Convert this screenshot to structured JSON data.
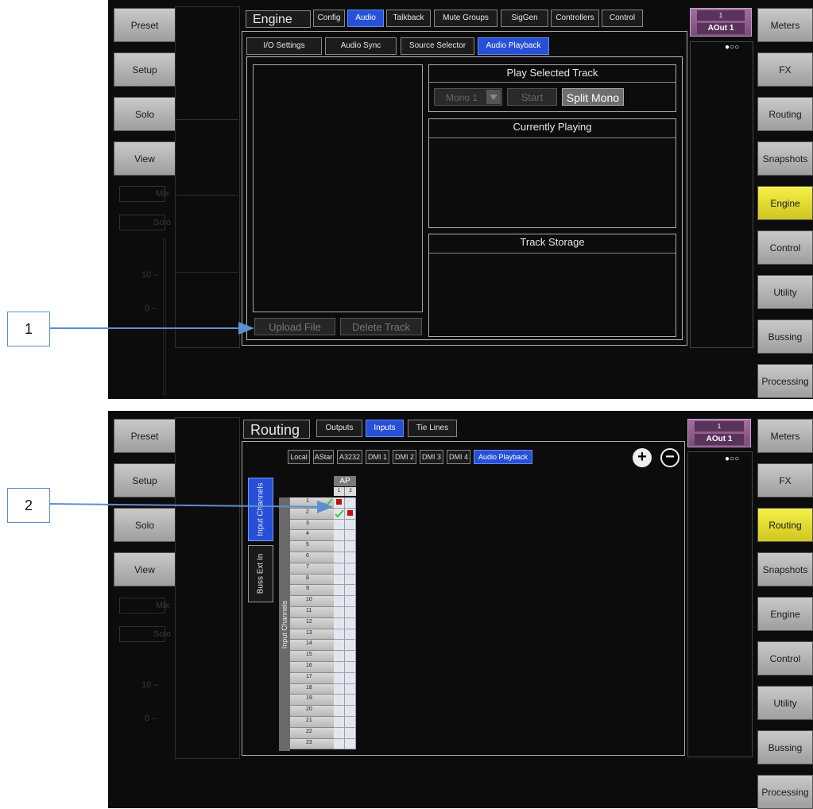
{
  "left_nav": [
    "Preset",
    "Setup",
    "Solo",
    "View"
  ],
  "ghost_labels": {
    "mix": "Mix",
    "solo": "Solo",
    "db10": "10 –",
    "db0": "0 –"
  },
  "top": {
    "right_nav": [
      "Meters",
      "FX",
      "Routing",
      "Snapshots",
      "Engine",
      "Control",
      "Utility",
      "Bussing",
      "Processing"
    ],
    "active_right": "Engine",
    "title": "Engine",
    "tabs": [
      "Config",
      "Audio",
      "Talkback",
      "Mute Groups",
      "SigGen",
      "Controllers",
      "Control"
    ],
    "active_tab": "Audio",
    "subtabs": [
      "I/O Settings",
      "Audio Sync",
      "Source Selector",
      "Audio Playback"
    ],
    "active_subtab": "Audio Playback",
    "output_badge": {
      "num": "1",
      "label": "AOut 1"
    },
    "page_dots": "●○○",
    "play_selected_track": "Play Selected Track",
    "mono_select": "Mono 1",
    "start": "Start",
    "split_mono": "Split Mono",
    "currently_playing": "Currently Playing",
    "track_storage": "Track Storage",
    "upload_file": "Upload File",
    "delete_track": "Delete Track"
  },
  "bottom": {
    "right_nav": [
      "Meters",
      "FX",
      "Routing",
      "Snapshots",
      "Engine",
      "Control",
      "Utility",
      "Bussing",
      "Processing"
    ],
    "active_right": "Routing",
    "title": "Routing",
    "tabs": [
      "Outputs",
      "Inputs",
      "Tie Lines"
    ],
    "active_tab": "Inputs",
    "sources": [
      "Local",
      "AStar",
      "A3232",
      "DMI 1",
      "DMI 2",
      "DMI 3",
      "DMI 4",
      "Audio Playback"
    ],
    "active_source": "Audio Playback",
    "output_badge": {
      "num": "1",
      "label": "AOut 1"
    },
    "page_dots": "●○○",
    "vtab_input_channels": "Input Channels",
    "vtab_buss_ext_in": "Buss Ext In",
    "matrix_side_label": "Input Channels",
    "matrix_header": "AP",
    "matrix_cols": [
      "1",
      "2"
    ],
    "matrix_rows": [
      "1",
      "2",
      "3",
      "4",
      "5",
      "6",
      "7",
      "8",
      "9",
      "10",
      "11",
      "12",
      "13",
      "14",
      "15",
      "16",
      "17",
      "18",
      "19",
      "20",
      "21",
      "22",
      "23"
    ],
    "connections": [
      [
        1,
        1
      ],
      [
        2,
        2
      ]
    ],
    "plus": "+",
    "minus": "−"
  },
  "callouts": [
    "1",
    "2"
  ],
  "colors": {
    "accent_blue": "#2750d8",
    "active_yellow": "#f0e93a",
    "badge_purple": "#8a5a8a",
    "patch_red": "#c01010",
    "check_green": "#3cc83c",
    "callout_blue": "#5b8fd0"
  }
}
